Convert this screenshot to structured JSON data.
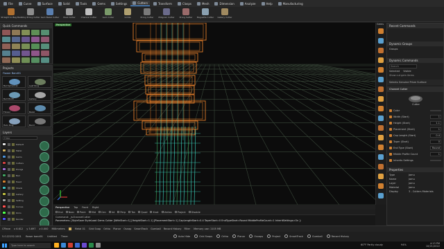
{
  "menu_tabs": [
    {
      "label": "File",
      "icon": "file-icon"
    },
    {
      "label": "Curve",
      "icon": "curve-icon"
    },
    {
      "label": "Surface",
      "icon": "surface-icon"
    },
    {
      "label": "Solid",
      "icon": "solid-icon"
    },
    {
      "label": "Tools",
      "icon": "tools-icon"
    },
    {
      "label": "Gems",
      "icon": "gems-icon"
    },
    {
      "label": "Settings",
      "icon": "settings-icon"
    },
    {
      "label": "Cutters",
      "icon": "cutters-icon"
    },
    {
      "label": "Transform",
      "icon": "transform-icon"
    },
    {
      "label": "Clasps",
      "icon": "clasps-icon"
    },
    {
      "label": "Mesh",
      "icon": "mesh-icon"
    },
    {
      "label": "Dimension",
      "icon": "dimension-icon"
    },
    {
      "label": "Analyze",
      "icon": "analyze-icon"
    },
    {
      "label": "Help",
      "icon": "help-icon"
    },
    {
      "label": "Manufacturing",
      "icon": "manufacturing-icon"
    }
  ],
  "active_tab": "Cutters",
  "toolbar": [
    {
      "label": "Straight to Bag Bail",
      "color": "#b07030"
    },
    {
      "label": "Alloy Prong Cutter",
      "color": "#8c8c8c"
    },
    {
      "label": "Gem Bezel Cutter",
      "color": "#5a7fb0"
    },
    {
      "label": "Pave Cutter",
      "color": "#a0a0a0"
    },
    {
      "label": "Channel Cutter",
      "color": "#c0c0c0"
    },
    {
      "label": "Gem Collar",
      "color": "#7a9a6a"
    },
    {
      "label": "Girdle",
      "color": "#b0a070"
    },
    {
      "label": "Prong Cutter",
      "color": "#7a7a7a"
    },
    {
      "label": "Millgrain Cutter",
      "color": "#6a6a8a"
    },
    {
      "label": "Prong Setter",
      "color": "#9a6a6a"
    },
    {
      "label": "Baguette Cutter",
      "color": "#8aa0b0"
    },
    {
      "label": "Gallery Cutter",
      "color": "#a08a60"
    }
  ],
  "quick_commands": {
    "title": "Quick Commands",
    "tools": [
      "select-icon",
      "point-icon",
      "line-icon",
      "circle-icon",
      "curve-icon",
      "move-icon",
      "rotate-icon",
      "scale-icon",
      "copy-icon",
      "mirror-icon",
      "array-icon",
      "trim-icon",
      "split-icon",
      "join-icon",
      "explode-icon",
      "boolean-icon",
      "fillet-icon",
      "extrude-icon",
      "loft-icon",
      "sweep-icon",
      "revolve-icon",
      "offset-icon",
      "gem-icon",
      "prong-icon",
      "render-icon"
    ]
  },
  "projects": {
    "title": "Projects",
    "current": "Flower Band01",
    "items": [
      {
        "label": "Ball Spherical",
        "tint": "#6fa7d8"
      },
      {
        "label": "Leaf Ring",
        "tint": "#7b8f6b"
      },
      {
        "label": "Ball Mod3",
        "tint": "#7ab0d0"
      },
      {
        "label": "Gallery",
        "tint": "#bfbfbf"
      },
      {
        "label": "Flower",
        "tint": "#c4527a"
      },
      {
        "label": "Bezel",
        "tint": "#6aa0c8"
      },
      {
        "label": "Halo Ring",
        "tint": "#9ab8d8"
      },
      {
        "label": "Band",
        "tint": "#8a8a8a"
      }
    ]
  },
  "layers": {
    "title": "Layers",
    "filter": "Filter",
    "rows": [
      {
        "name": "Default",
        "color": "#e0e0e0"
      },
      {
        "name": "Metal",
        "color": "#d0b060"
      },
      {
        "name": "Gems",
        "color": "#4a8fd8"
      },
      {
        "name": "Cutters",
        "color": "#d04040"
      },
      {
        "name": "Prongs",
        "color": "#9a6ad0"
      },
      {
        "name": "Bail",
        "color": "#40a060"
      },
      {
        "name": "Head",
        "color": "#d08030"
      },
      {
        "name": "Shank",
        "color": "#40c0c0"
      },
      {
        "name": "Gallery",
        "color": "#c0c040"
      },
      {
        "name": "Setting",
        "color": "#a0a0a0"
      },
      {
        "name": "Curves",
        "color": "#ff5050"
      },
      {
        "name": "Dims",
        "color": "#50ff50"
      },
      {
        "name": "Render",
        "color": "#5050ff"
      }
    ],
    "hide_label": "Hide Additional Layers"
  },
  "viewport": {
    "name": "Perspective",
    "tabs": [
      "Perspective",
      "Top",
      "Front",
      "Right"
    ],
    "active": "Perspective"
  },
  "right_strip": {
    "label": "Gems",
    "icons": [
      "diamond-icon",
      "emerald-icon",
      "oval-icon",
      "pear-icon",
      "marquise-icon",
      "heart-icon",
      "princess-icon",
      "cushion-icon",
      "trillion-icon",
      "baguette-icon",
      "asscher-icon",
      "radiant-icon",
      "rose-cut-icon",
      "briolette-icon",
      "cabochon-icon",
      "pearl-icon",
      "star-icon",
      "custom-gem-icon"
    ]
  },
  "recent_commands": {
    "title": "Recent Commands"
  },
  "dynamic_groups": {
    "title": "Dynamic Groups",
    "group": "Groups"
  },
  "dynamic_commands": {
    "title": "Dynamic Commands",
    "search": "Search",
    "filter_selected": "Selected",
    "filter_visible": "Visible",
    "crumb1": "Show cut gem items",
    "section1": "Selects Genuine Prism Surface",
    "section2": "Channel Cutter",
    "preview_caption": "Cutter",
    "params": [
      {
        "label": "Color",
        "value": ""
      },
      {
        "label": "Width (Start)",
        "value": "1"
      },
      {
        "label": "Height (Start)",
        "value": "1.1"
      },
      {
        "label": "Placement (Start)",
        "value": "1"
      },
      {
        "label": "Cap Length (Start)",
        "value": "0.4"
      },
      {
        "label": "Taper (Start)",
        "value": "0"
      },
      {
        "label": "End Type (Start)",
        "value": "Round"
      },
      {
        "label": "Middle Profile Count",
        "value": "1"
      },
      {
        "label": "Inherits Settings",
        "value": ""
      }
    ]
  },
  "properties": {
    "title": "Properties",
    "rows": [
      {
        "k": "Type",
        "v": "Jamu"
      },
      {
        "k": "Name",
        "v": "Jamu"
      },
      {
        "k": "Layer",
        "v": "Jamu"
      },
      {
        "k": "Material",
        "v": "Jamu"
      },
      {
        "k": "Display",
        "v": "3 - Cutters Materials"
      }
    ]
  },
  "osnap": {
    "items": [
      "End",
      "Near",
      "Point",
      "Mid",
      "Cen",
      "Int",
      "Perp",
      "Tan",
      "Quad",
      "Knot",
      "Vertex",
      "Project",
      "Disable"
    ]
  },
  "command": {
    "line1": "Command: _jsChannelCutter",
    "line2": "Parameters: [StyleSave  StyleLoad  Gems  Cutter  [WithStart=1]  [HeightStart=1.1]  [PlacementStart=1]  CapLengthStart=0.4  TaperStart=0  EndTypeStart=Round  MiddleProfileCount=1  InheritSettings=On ]:"
  },
  "status": {
    "cplane": "CPlane",
    "x": "x 6.612",
    "y": "y 5.697",
    "z": "z 0.000",
    "units": "Millimeters",
    "layer": "Metal 01",
    "buttons": [
      "Grid Snap",
      "Ortho",
      "Planar",
      "Osnap",
      "SmartTrack",
      "Gumball",
      "Record History",
      "Filter"
    ],
    "memory": "Memory use: 1105 MB"
  },
  "status2": {
    "file": "5.0.22152.1001",
    "model": "flower band01",
    "updated": "Untitled",
    "timer": "Timer",
    "toggles": [
      "Auto Hide",
      "Grid Snaps",
      "Ortho",
      "Planar",
      "Osnaps",
      "Project",
      "SmartTrack",
      "Gumball",
      "Record History"
    ]
  },
  "taskbar": {
    "search": "Type here to search",
    "weather": "60°F  Partly cloudy",
    "time": "4:13 PM",
    "date": "10/21/2022",
    "battery": "94%"
  },
  "colors": {
    "accent": "#4aa0ff",
    "grid": "#3a4a3a",
    "orange": "#ff8c2e",
    "cyan": "#3fe0c8",
    "green": "#3fb060"
  }
}
